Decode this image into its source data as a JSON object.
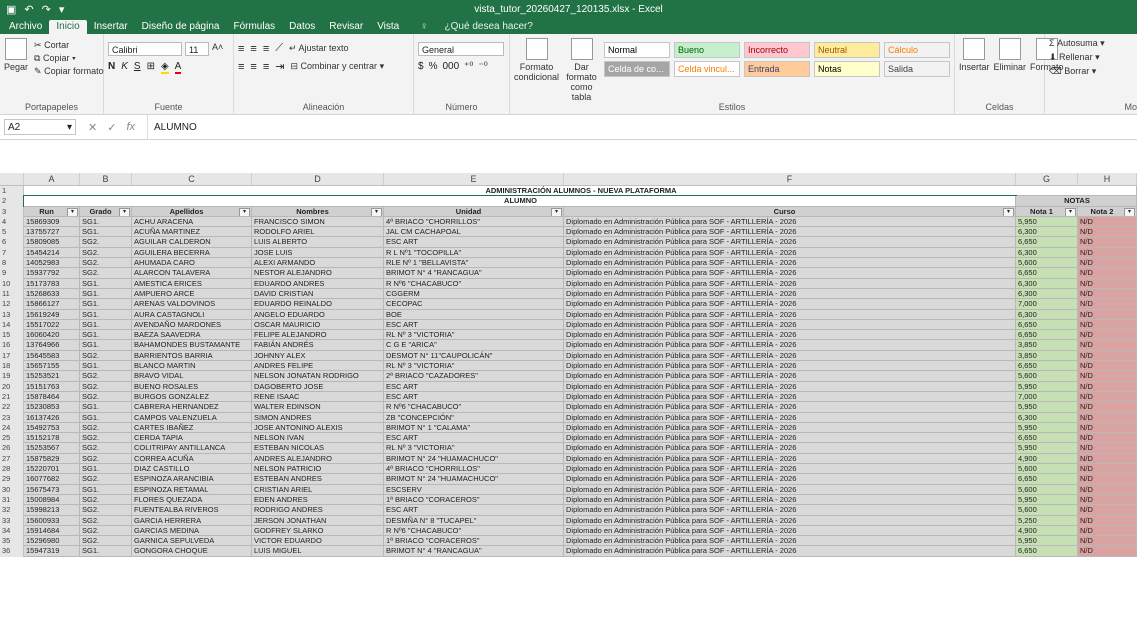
{
  "window": {
    "title": "vista_tutor_20260427_120135.xlsx - Excel"
  },
  "tabs": [
    "Archivo",
    "Inicio",
    "Insertar",
    "Diseño de página",
    "Fórmulas",
    "Datos",
    "Revisar",
    "Vista"
  ],
  "tell_me": "¿Qué desea hacer?",
  "ribbon": {
    "clipboard": {
      "paste": "Pegar",
      "cut": "Cortar",
      "copy": "Copiar",
      "format_painter": "Copiar formato",
      "label": "Portapapeles"
    },
    "font": {
      "name": "Calibri",
      "size": "11",
      "bold": "N",
      "italic": "K",
      "underline": "S",
      "label": "Fuente"
    },
    "alignment": {
      "wrap": "Ajustar texto",
      "merge": "Combinar y centrar",
      "label": "Alineación"
    },
    "number": {
      "format": "General",
      "currency": "$",
      "percent": "%",
      "thousands": "000",
      "label": "Número"
    },
    "styles": {
      "cond_format": "Formato condicional",
      "format_table": "Dar formato como tabla",
      "label": "Estilos",
      "cells": [
        {
          "text": "Normal",
          "bg": "#ffffff",
          "fg": "#000000"
        },
        {
          "text": "Bueno",
          "bg": "#c6efce",
          "fg": "#006100"
        },
        {
          "text": "Incorrecto",
          "bg": "#ffc7ce",
          "fg": "#9c0006"
        },
        {
          "text": "Neutral",
          "bg": "#ffeb9c",
          "fg": "#9c5700"
        },
        {
          "text": "Cálculo",
          "bg": "#f2f2f2",
          "fg": "#fa7d00"
        },
        {
          "text": "Celda de co...",
          "bg": "#a5a5a5",
          "fg": "#ffffff"
        },
        {
          "text": "Celda vincul...",
          "bg": "#ffffff",
          "fg": "#fa7d00"
        },
        {
          "text": "Entrada",
          "bg": "#ffcc99",
          "fg": "#3f3f76"
        },
        {
          "text": "Notas",
          "bg": "#ffffcc",
          "fg": "#000000"
        },
        {
          "text": "Salida",
          "bg": "#f2f2f2",
          "fg": "#3f3f3f"
        }
      ]
    },
    "cells": {
      "insert": "Insertar",
      "delete": "Eliminar",
      "format": "Formato",
      "label": "Celdas"
    },
    "editing": {
      "autosum": "Autosuma",
      "fill": "Rellenar",
      "clear": "Borrar",
      "label": "Mo"
    }
  },
  "formula_bar": {
    "cell_ref": "A2",
    "value": "ALUMNO",
    "fx": "fx"
  },
  "columns": [
    "A",
    "B",
    "C",
    "D",
    "E",
    "F",
    "G",
    "H"
  ],
  "sheet": {
    "title": "ADMINISTRACIÓN ALUMNOS - NUEVA PLATAFORMA",
    "group_alumno": "ALUMNO",
    "group_notas": "NOTAS",
    "headers": [
      "Run",
      "Grado",
      "Apellidos",
      "Nombres",
      "Unidad",
      "Curso",
      "Nota 1",
      "Nota 2"
    ],
    "rows": [
      [
        "15869309",
        "SG1.",
        "ACHU ARACENA",
        "FRANCISCO SIMON",
        "4ª BRIACO \"CHORRILLOS\"",
        "Diplomado en Administración Pública para SOF - ARTILLERÍA - 2026",
        "5,950",
        "N/D"
      ],
      [
        "13755727",
        "SG1.",
        "ACUÑA MARTINEZ",
        "RODOLFO ARIEL",
        "JAL CM CACHAPOAL",
        "Diplomado en Administración Pública para SOF - ARTILLERÍA - 2026",
        "6,300",
        "N/D"
      ],
      [
        "15809085",
        "SG2.",
        "AGUILAR CALDERON",
        "LUIS ALBERTO",
        "ESC ART",
        "Diplomado en Administración Pública para SOF - ARTILLERÍA - 2026",
        "6,650",
        "N/D"
      ],
      [
        "15454214",
        "SG2.",
        "AGUILERA BECERRA",
        "JOSE LUIS",
        "R L Nº1 \"TOCOPILLA\"",
        "Diplomado en Administración Pública para SOF - ARTILLERÍA - 2026",
        "6,300",
        "N/D"
      ],
      [
        "14052983",
        "SG2.",
        "AHUMADA CARO",
        "ALEXI ARMANDO",
        "RLE Nº 1 \"BELLAVISTA\"",
        "Diplomado en Administración Pública para SOF - ARTILLERÍA - 2026",
        "5,600",
        "N/D"
      ],
      [
        "15937792",
        "SG2.",
        "ALARCON TALAVERA",
        "NESTOR ALEJANDRO",
        "BRIMOT N° 4 \"RANCAGUA\"",
        "Diplomado en Administración Pública para SOF - ARTILLERÍA - 2026",
        "6,650",
        "N/D"
      ],
      [
        "15173783",
        "SG1.",
        "AMESTICA ERICES",
        "EDUARDO ANDRES",
        "R Nº6 \"CHACABUCO\"",
        "Diplomado en Administración Pública para SOF - ARTILLERÍA - 2026",
        "6,300",
        "N/D"
      ],
      [
        "15268633",
        "SG1.",
        "AMPUERO ARCE",
        "DAVID CRISTIAN",
        "CGGERM",
        "Diplomado en Administración Pública para SOF - ARTILLERÍA - 2026",
        "6,300",
        "N/D"
      ],
      [
        "15866127",
        "SG1.",
        "ARENAS VALDOVINOS",
        "EDUARDO REINALDO",
        "CECOPAC",
        "Diplomado en Administración Pública para SOF - ARTILLERÍA - 2026",
        "7,000",
        "N/D"
      ],
      [
        "15619249",
        "SG1.",
        "AURA CASTAGNOLI",
        "ANGELO EDUARDO",
        "BOE",
        "Diplomado en Administración Pública para SOF - ARTILLERÍA - 2026",
        "6,300",
        "N/D"
      ],
      [
        "15517022",
        "SG1.",
        "AVENDAÑO MARDONES",
        "OSCAR MAURICIO",
        "ESC ART",
        "Diplomado en Administración Pública para SOF - ARTILLERÍA - 2026",
        "6,650",
        "N/D"
      ],
      [
        "16060420",
        "SG1.",
        "BAEZA SAAVEDRA",
        "FELIPE ALEJANDRO",
        "RL Nº 3 \"VICTORIA\"",
        "Diplomado en Administración Pública para SOF - ARTILLERÍA - 2026",
        "6,650",
        "N/D"
      ],
      [
        "13764966",
        "SG1.",
        "BAHAMONDES BUSTAMANTE",
        "FABIÁN ANDRÉS",
        "C G E \"ARICA\"",
        "Diplomado en Administración Pública para SOF - ARTILLERÍA - 2026",
        "3,850",
        "N/D"
      ],
      [
        "15645583",
        "SG2.",
        "BARRIENTOS BARRIA",
        "JOHNNY ALEX",
        "DESMOT N° 11\"CAUPOLICÁN\"",
        "Diplomado en Administración Pública para SOF - ARTILLERÍA - 2026",
        "3,850",
        "N/D"
      ],
      [
        "15657155",
        "SG1.",
        "BLANCO MARTIN",
        "ANDRES FELIPE",
        "RL Nº 3 \"VICTORIA\"",
        "Diplomado en Administración Pública para SOF - ARTILLERÍA - 2026",
        "6,650",
        "N/D"
      ],
      [
        "15253521",
        "SG2.",
        "BRAVO VIDAL",
        "NELSON JONATAN RODRIGO",
        "2ª BRIACO \"CAZADORES\"",
        "Diplomado en Administración Pública para SOF - ARTILLERÍA - 2026",
        "5,600",
        "N/D"
      ],
      [
        "15151763",
        "SG2.",
        "BUENO ROSALES",
        "DAGOBERTO JOSE",
        "ESC ART",
        "Diplomado en Administración Pública para SOF - ARTILLERÍA - 2026",
        "5,950",
        "N/D"
      ],
      [
        "15878464",
        "SG2.",
        "BURGOS GONZALEZ",
        "RENE ISAAC",
        "ESC ART",
        "Diplomado en Administración Pública para SOF - ARTILLERÍA - 2026",
        "7,000",
        "N/D"
      ],
      [
        "15230853",
        "SG1.",
        "CABRERA HERNANDEZ",
        "WALTER EDINSON",
        "R Nº6 \"CHACABUCO\"",
        "Diplomado en Administración Pública para SOF - ARTILLERÍA - 2026",
        "5,950",
        "N/D"
      ],
      [
        "16137426",
        "SG1.",
        "CAMPOS VALENZUELA",
        "SIMON ANDRES",
        "ZB \"CONCEPCIÓN\"",
        "Diplomado en Administración Pública para SOF - ARTILLERÍA - 2026",
        "6,300",
        "N/D"
      ],
      [
        "15492753",
        "SG2.",
        "CARTES IBAÑEZ",
        "JOSE ANTONINO ALEXIS",
        "BRIMOT N° 1 \"CALAMA\"",
        "Diplomado en Administración Pública para SOF - ARTILLERÍA - 2026",
        "5,950",
        "N/D"
      ],
      [
        "15152178",
        "SG2.",
        "CERDA TAPIA",
        "NELSON IVAN",
        "ESC ART",
        "Diplomado en Administración Pública para SOF - ARTILLERÍA - 2026",
        "6,650",
        "N/D"
      ],
      [
        "15253567",
        "SG2.",
        "COLITRIPAY ANTILLANCA",
        "ESTEBAN NICOLAS",
        "RL Nº 3 \"VICTORIA\"",
        "Diplomado en Administración Pública para SOF - ARTILLERÍA - 2026",
        "5,950",
        "N/D"
      ],
      [
        "15875829",
        "SG2.",
        "CORREA ACUÑA",
        "ANDRES ALEJANDRO",
        "BRIMOT N° 24 \"HUAMACHUCO\"",
        "Diplomado en Administración Pública para SOF - ARTILLERÍA - 2026",
        "4,900",
        "N/D"
      ],
      [
        "15220701",
        "SG1.",
        "DIAZ CASTILLO",
        "NELSON PATRICIO",
        "4ª BRIACO \"CHORRILLOS\"",
        "Diplomado en Administración Pública para SOF - ARTILLERÍA - 2026",
        "5,600",
        "N/D"
      ],
      [
        "16077682",
        "SG2.",
        "ESPINOZA ARANCIBIA",
        "ESTEBAN ANDRES",
        "BRIMOT N° 24 \"HUAMACHUCO\"",
        "Diplomado en Administración Pública para SOF - ARTILLERÍA - 2026",
        "6,650",
        "N/D"
      ],
      [
        "15675473",
        "SG1.",
        "ESPINOZA RETAMAL",
        "CRISTIAN ARIEL",
        "ESCSERV",
        "Diplomado en Administración Pública para SOF - ARTILLERÍA - 2026",
        "5,600",
        "N/D"
      ],
      [
        "15008984",
        "SG2.",
        "FLORES QUEZADA",
        "EDEN ANDRES",
        "1ª BRIACO \"CORACEROS\"",
        "Diplomado en Administración Pública para SOF - ARTILLERÍA - 2026",
        "5,950",
        "N/D"
      ],
      [
        "15998213",
        "SG2.",
        "FUENTEALBA RIVEROS",
        "RODRIGO ANDRES",
        "ESC ART",
        "Diplomado en Administración Pública para SOF - ARTILLERÍA - 2026",
        "5,600",
        "N/D"
      ],
      [
        "15600933",
        "SG2.",
        "GARCIA HERRERA",
        "JERSON JONATHAN",
        "DESMÑA N° 8 \"TUCAPEL\"",
        "Diplomado en Administración Pública para SOF - ARTILLERÍA - 2026",
        "5,250",
        "N/D"
      ],
      [
        "15914684",
        "SG2.",
        "GARCIAS MEDINA",
        "GODFREY SLARKO",
        "R Nº6 \"CHACABUCO\"",
        "Diplomado en Administración Pública para SOF - ARTILLERÍA - 2026",
        "4,900",
        "N/D"
      ],
      [
        "15296980",
        "SG2.",
        "GARNICA SEPULVEDA",
        "VICTOR EDUARDO",
        "1ª BRIACO \"CORACEROS\"",
        "Diplomado en Administración Pública para SOF - ARTILLERÍA - 2026",
        "5,950",
        "N/D"
      ],
      [
        "15947319",
        "SG1.",
        "GONGORA CHOQUE",
        "LUIS MIGUEL",
        "BRIMOT N° 4 \"RANCAGUA\"",
        "Diplomado en Administración Pública para SOF - ARTILLERÍA - 2026",
        "6,650",
        "N/D"
      ]
    ]
  }
}
